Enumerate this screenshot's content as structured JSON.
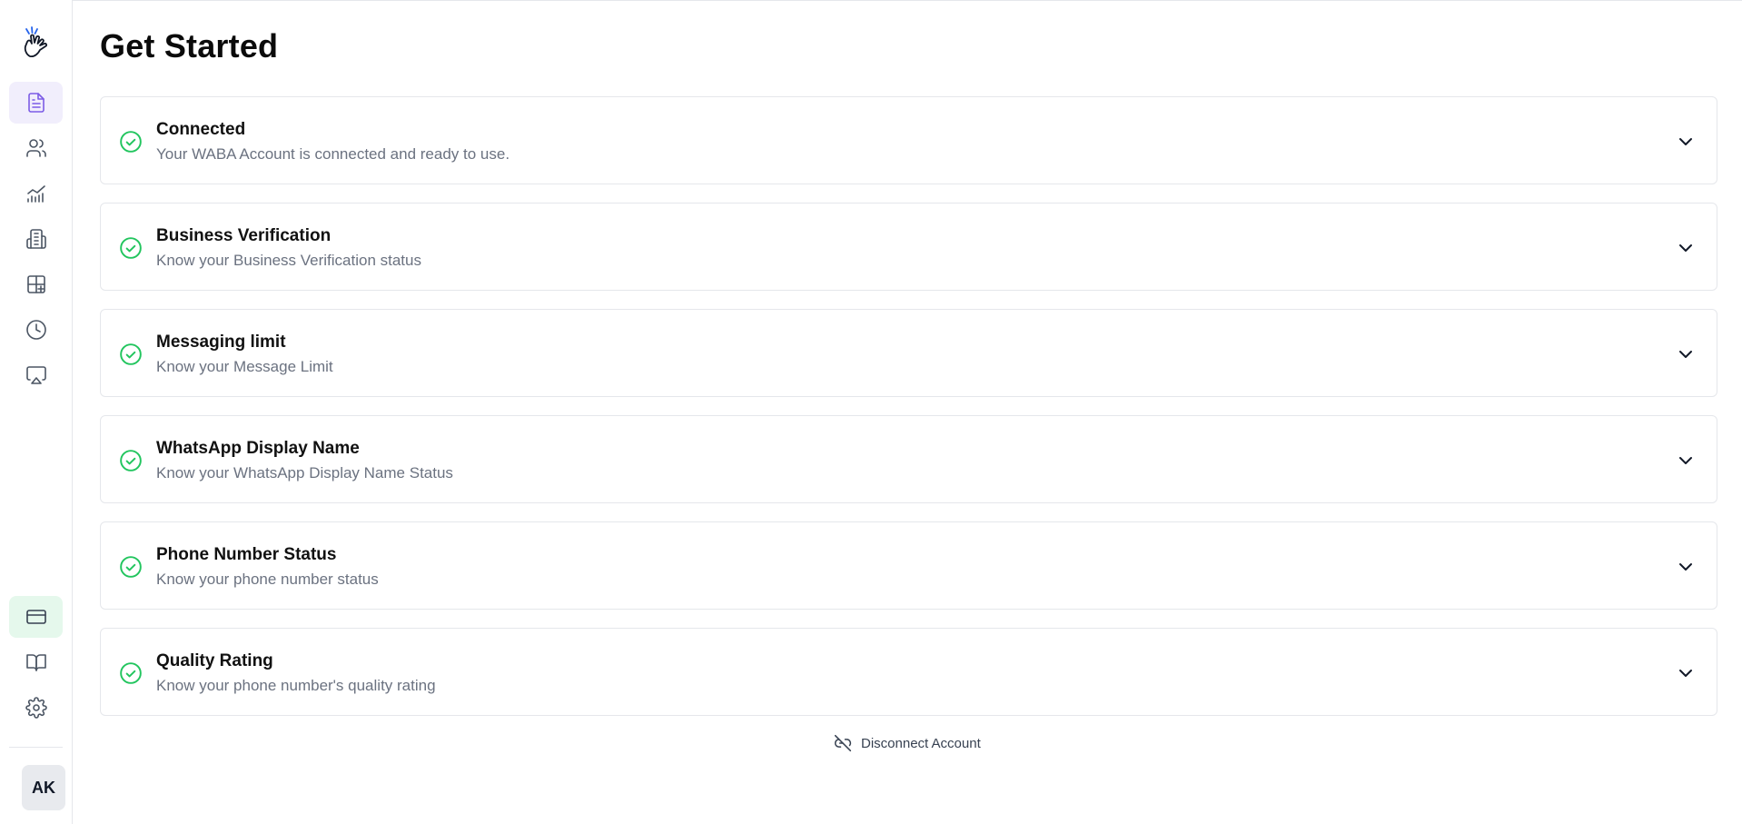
{
  "page": {
    "title": "Get Started"
  },
  "sidebar": {
    "logo": "hand-wave-logo",
    "top_items": [
      {
        "name": "documents",
        "icon": "document-icon",
        "active": true
      },
      {
        "name": "contacts",
        "icon": "users-icon",
        "active": false
      },
      {
        "name": "analytics",
        "icon": "chart-icon",
        "active": false
      },
      {
        "name": "business",
        "icon": "building-icon",
        "active": false
      },
      {
        "name": "templates",
        "icon": "layout-plus-icon",
        "active": false
      },
      {
        "name": "history",
        "icon": "clock-icon",
        "active": false
      },
      {
        "name": "broadcast",
        "icon": "airplay-icon",
        "active": false
      }
    ],
    "bottom_items": [
      {
        "name": "billing",
        "icon": "credit-card-icon",
        "active": true
      },
      {
        "name": "docs",
        "icon": "book-open-icon",
        "active": false
      },
      {
        "name": "settings",
        "icon": "gear-icon",
        "active": false
      }
    ],
    "avatar_initials": "AK"
  },
  "cards": [
    {
      "title": "Connected",
      "subtitle": "Your WABA Account is connected and ready to use."
    },
    {
      "title": "Business Verification",
      "subtitle": "Know your Business Verification status"
    },
    {
      "title": "Messaging limit",
      "subtitle": "Know your Message Limit"
    },
    {
      "title": "WhatsApp Display Name",
      "subtitle": "Know your WhatsApp Display Name Status"
    },
    {
      "title": "Phone Number Status",
      "subtitle": "Know your phone number status"
    },
    {
      "title": "Quality Rating",
      "subtitle": "Know your phone number's quality rating"
    }
  ],
  "disconnect": {
    "label": "Disconnect Account",
    "icon": "unlink-icon"
  },
  "colors": {
    "accent_purple": "#7c5ce6",
    "check_green": "#22c55e",
    "active_green_bg": "#e5f8ec",
    "active_purple_bg": "#f1eefc"
  }
}
